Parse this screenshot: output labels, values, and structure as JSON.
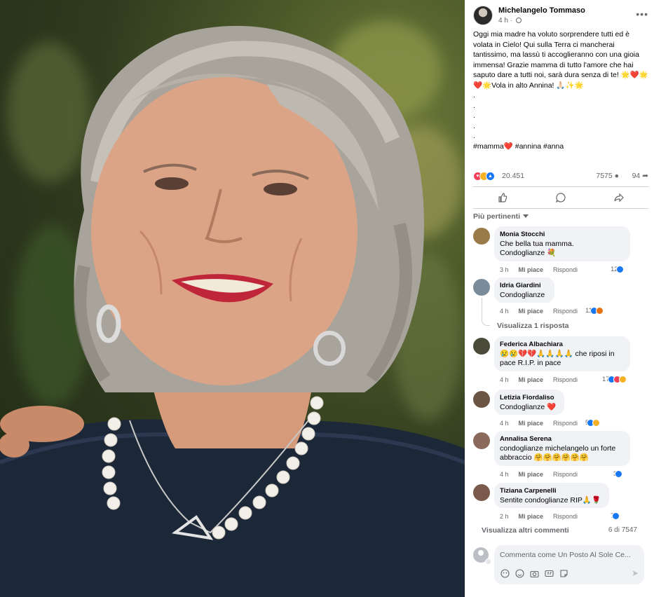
{
  "post": {
    "author": "Michelangelo Tommaso",
    "time": "4 h",
    "lines": [
      "Oggi mia madre ha voluto sorprendere tutti ed è volata in Cielo! Qui sulla Terra ci mancherai tantissimo, ma lassù ti accoglieranno con una gioia immensa! Grazie mamma di tutto l'amore che hai saputo dare a tutti noi, sarà dura senza di te! 🌟❤️🌟❤️🌟Vola in alto Annina! 🙏🏻✨🌟",
      ".",
      ".",
      ".",
      ".",
      ".",
      "#mamma❤️ #annina #anna"
    ],
    "reactions_count": "20.451",
    "comments_count": "7575",
    "shares_count": "94",
    "icons": {
      "more": "more-horizontal-icon",
      "globe": "globe-icon",
      "like": "like-icon",
      "comment": "comment-icon",
      "share": "share-icon"
    }
  },
  "sort_label": "Più pertinenti",
  "comments": [
    {
      "name": "Monia Stocchi",
      "text": "Che bella tua mamma.\nCondoglianze 💐",
      "time": "3 h",
      "like": "Mi piace",
      "reply": "Rispondi",
      "reactions": "12",
      "avatar_color": "#9a7a48"
    },
    {
      "name": "Idria Giardini",
      "text": "Condoglianze",
      "time": "4 h",
      "like": "Mi piace",
      "reply": "Rispondi",
      "reactions": "11",
      "avatar_color": "#7a8c9a"
    },
    {
      "name": "Federica Albachiara",
      "text": "😢😢💔💔🙏🙏🙏🙏 che riposi in pace R.I.P. in pace",
      "time": "4 h",
      "like": "Mi piace",
      "reply": "Rispondi",
      "reactions": "17",
      "avatar_color": "#4a4a3a"
    },
    {
      "name": "Letizia Fiordaliso",
      "text": "Condoglianze ❤️",
      "time": "4 h",
      "like": "Mi piace",
      "reply": "Rispondi",
      "reactions": "5",
      "avatar_color": "#6b5444"
    },
    {
      "name": "Annalisa Serena",
      "text": "condoglianze michelangelo un forte abbraccio 🤗🤗🤗🤗🤗🤗",
      "time": "4 h",
      "like": "Mi piace",
      "reply": "Rispondi",
      "reactions": "3",
      "avatar_color": "#8a6a5a"
    },
    {
      "name": "Tiziana Carpenelli",
      "text": "Sentite condoglianze RIP🙏🌹",
      "time": "2 h",
      "like": "Mi piace",
      "reply": "Rispondi",
      "reactions": "7",
      "avatar_color": "#7a5a4a"
    }
  ],
  "view_replies": "Visualizza 1 risposta",
  "more_comments": "Visualizza altri commenti",
  "page_count": "6 di 7547",
  "composer": {
    "placeholder": "Commenta come Un Posto Al Sole Ce..."
  }
}
